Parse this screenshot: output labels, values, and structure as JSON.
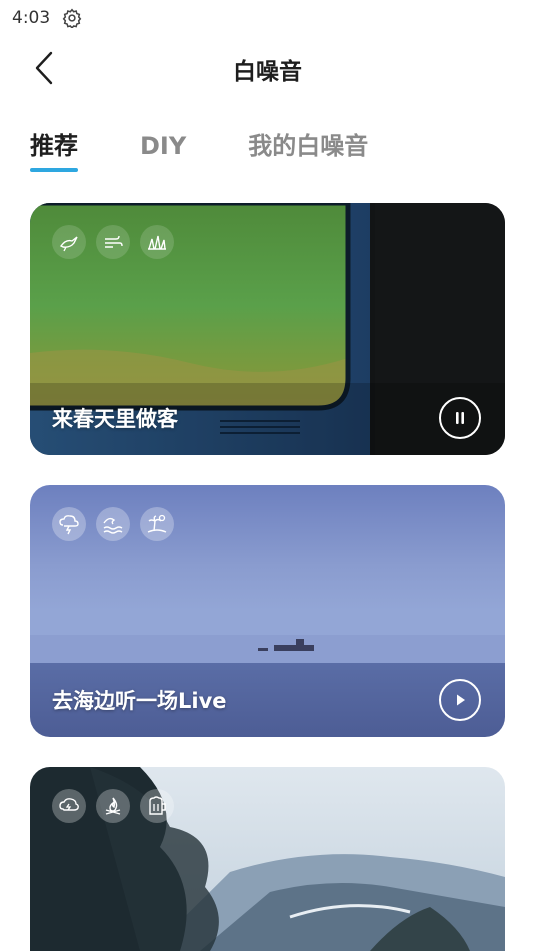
{
  "status_bar": {
    "time": "4:03",
    "icon": "gear-icon"
  },
  "nav": {
    "title": "白噪音",
    "back_icon": "chevron-left-icon"
  },
  "tabs": [
    {
      "label": "推荐",
      "active": true
    },
    {
      "label": "DIY",
      "active": false
    },
    {
      "label": "我的白噪音",
      "active": false
    }
  ],
  "colors": {
    "accent": "#2ea7e0",
    "title": "#1e1e1e",
    "inactive_tab": "#8a8a8a"
  },
  "cards": [
    {
      "title": "来春天里做客",
      "state": "playing",
      "control_icon": "pause-icon",
      "icons": [
        "bird-icon",
        "wind-icon",
        "grass-icon"
      ]
    },
    {
      "title": "去海边听一场Live",
      "state": "paused",
      "control_icon": "play-icon",
      "icons": [
        "thunderstorm-icon",
        "waves-icon",
        "beach-icon"
      ]
    },
    {
      "title": "",
      "state": "",
      "control_icon": "",
      "icons": [
        "thunder-cloud-icon",
        "campfire-icon",
        "beer-icon"
      ]
    }
  ]
}
